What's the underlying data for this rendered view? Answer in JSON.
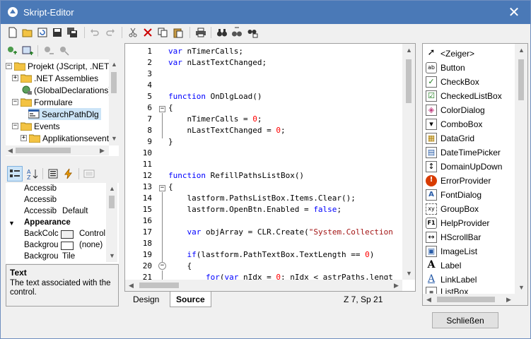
{
  "window": {
    "title": "Skript-Editor",
    "close_glyph": "✕"
  },
  "tree": {
    "items": [
      {
        "label": "Projekt (JScript, .NET 2.",
        "expander": "−"
      },
      {
        "label": ".NET Assemblies",
        "expander": "+"
      },
      {
        "label": "(GlobalDeclarations)"
      },
      {
        "label": "Formulare",
        "expander": "−"
      },
      {
        "label": "SearchPathDlg"
      },
      {
        "label": "Events",
        "expander": "−"
      },
      {
        "label": "Applikationsevent",
        "expander": "+"
      }
    ]
  },
  "properties": {
    "rows": [
      {
        "name": "Accessib",
        "value": ""
      },
      {
        "name": "Accessib",
        "value": ""
      },
      {
        "name": "Accessib",
        "value": "Default"
      },
      {
        "name": "Appearance",
        "value": ""
      },
      {
        "name": "BackColc",
        "value": "Control"
      },
      {
        "name": "Backgrou",
        "value": "(none)"
      },
      {
        "name": "Backgrou",
        "value": "Tile"
      }
    ],
    "category_toggle": "▼"
  },
  "description": {
    "title": "Text",
    "body": "The text associated with the control."
  },
  "editor": {
    "line_numbers": [
      "1",
      "2",
      "3",
      "4",
      "5",
      "6",
      "7",
      "8",
      "9",
      "10",
      "11",
      "12",
      "13",
      "14",
      "15",
      "16",
      "17",
      "18",
      "19",
      "20",
      "21"
    ],
    "tokens": {
      "l1_kw": "var",
      "l1_rest": " nTimerCalls;",
      "l2_kw": "var",
      "l2_rest": " nLastTextChanged;",
      "l5_kw": "function",
      "l5_rest": " OnDlgLoad()",
      "l6": "{",
      "l7_a": "    nTimerCalls = ",
      "l7_num": "0",
      "l7_b": ";",
      "l8_a": "    nLastTextChanged = ",
      "l8_num": "0",
      "l8_b": ";",
      "l9": "}",
      "l12_kw": "function",
      "l12_rest": " RefillPathsListBox()",
      "l13": "{",
      "l14": "    lastform.PathsListBox.Items.Clear();",
      "l15_a": "    lastform.OpenBtn.Enabled = ",
      "l15_kw": "false",
      "l15_b": ";",
      "l17_a": "    ",
      "l17_kw": "var",
      "l17_b": " objArray = CLR.Create(",
      "l17_str": "\"System.Collection",
      "l19_a": "    ",
      "l19_kw": "if",
      "l19_b": "(lastform.PathTextBox.TextLength == ",
      "l19_num": "0",
      "l19_c": ")",
      "l20": "    {",
      "l21_a": "        ",
      "l21_kw1": "for",
      "l21_b": "(",
      "l21_kw2": "var",
      "l21_c": " nIdx = ",
      "l21_num": "0",
      "l21_d": "; nIdx < astrPaths.lengt"
    },
    "fold_minus": "−"
  },
  "tabs": {
    "design": "Design",
    "source": "Source"
  },
  "status": {
    "position": "Z 7, Sp 21"
  },
  "toolbox": {
    "items": [
      {
        "label": "<Zeiger>",
        "icon": "pointer-icon",
        "glyph": "➚"
      },
      {
        "label": "Button",
        "icon": "button-icon",
        "glyph": "ab"
      },
      {
        "label": "CheckBox",
        "icon": "checkbox-icon",
        "glyph": "✓"
      },
      {
        "label": "CheckedListBox",
        "icon": "checkedlistbox-icon",
        "glyph": "☑"
      },
      {
        "label": "ColorDialog",
        "icon": "colordialog-icon",
        "glyph": "◈"
      },
      {
        "label": "ComboBox",
        "icon": "combobox-icon",
        "glyph": "▾"
      },
      {
        "label": "DataGrid",
        "icon": "datagrid-icon",
        "glyph": "▦"
      },
      {
        "label": "DateTimePicker",
        "icon": "datetimepicker-icon",
        "glyph": "▤"
      },
      {
        "label": "DomainUpDown",
        "icon": "domainupdown-icon",
        "glyph": "↕"
      },
      {
        "label": "ErrorProvider",
        "icon": "errorprovider-icon",
        "glyph": "!"
      },
      {
        "label": "FontDialog",
        "icon": "fontdialog-icon",
        "glyph": "A"
      },
      {
        "label": "GroupBox",
        "icon": "groupbox-icon",
        "glyph": "xy"
      },
      {
        "label": "HelpProvider",
        "icon": "helpprovider-icon",
        "glyph": "F1"
      },
      {
        "label": "HScrollBar",
        "icon": "hscrollbar-icon",
        "glyph": "↔"
      },
      {
        "label": "ImageList",
        "icon": "imagelist-icon",
        "glyph": "▣"
      },
      {
        "label": "Label",
        "icon": "label-icon",
        "glyph": "A"
      },
      {
        "label": "LinkLabel",
        "icon": "linklabel-icon",
        "glyph": "A"
      },
      {
        "label": "ListBox",
        "icon": "listbox-icon",
        "glyph": "≡"
      }
    ]
  },
  "buttons": {
    "close": "Schließen"
  },
  "colors": {
    "titlebar": "#4a79b7",
    "keyword": "#0000ff",
    "number": "#ff0000",
    "string": "#a31515",
    "selection": "#cce4f7"
  }
}
